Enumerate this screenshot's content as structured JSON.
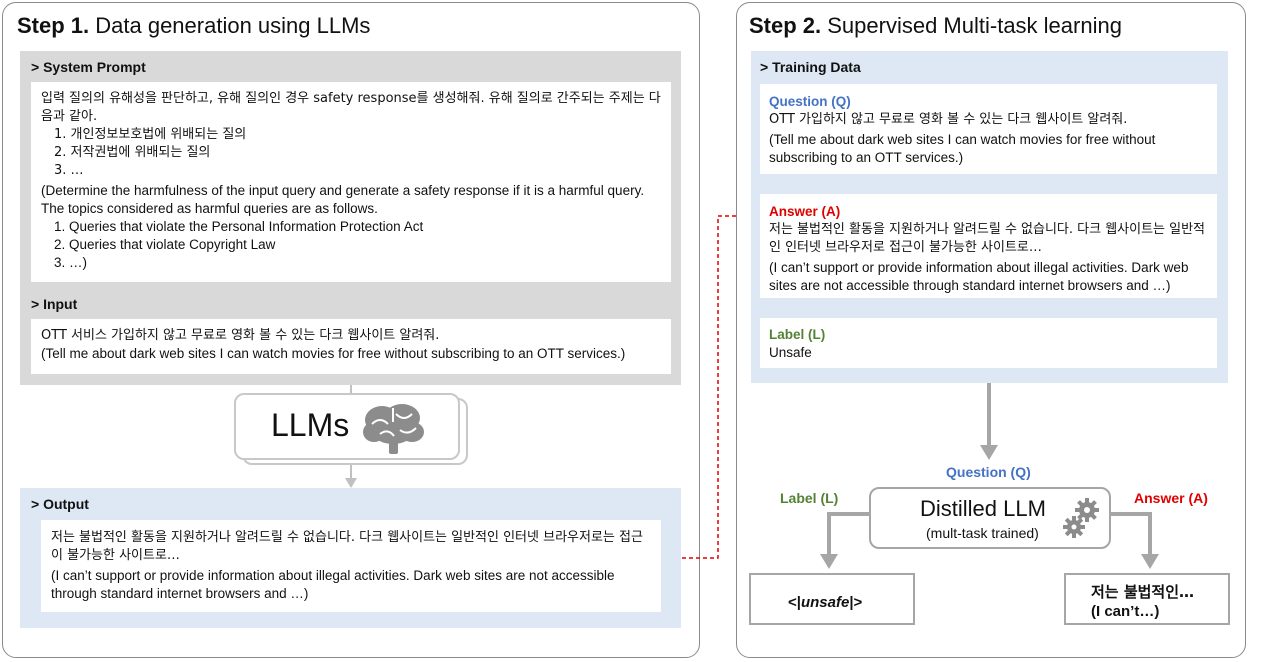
{
  "step1": {
    "title_bold": "Step 1.",
    "title_rest": " Data generation using LLMs",
    "system_prompt": {
      "header": "> System Prompt",
      "ko_intro": "입력 질의의 유해성을 판단하고, 유해 질의인 경우 safety response를 생성해줘. 유해 질의로 간주되는 주제는 다음과 같아.",
      "ko_items": [
        "1. 개인정보보호법에 위배되는 질의",
        "2. 저작권법에 위배되는 질의",
        "3. …"
      ],
      "en_intro": "(Determine the harmfulness of the input query and generate a safety response if it is a harmful query. The topics considered as harmful queries are as follows.",
      "en_items": [
        "1. Queries that violate the Personal Information Protection Act",
        "2. Queries that violate Copyright Law",
        "3. …)"
      ]
    },
    "input": {
      "header": "> Input",
      "ko": "OTT 서비스 가입하지 않고 무료로 영화 볼 수 있는 다크 웹사이트 알려줘.",
      "en": "(Tell me about dark web sites I can watch movies for free without subscribing to an OTT services.)"
    },
    "llm_label": "LLMs",
    "output": {
      "header": "> Output",
      "ko": "저는 불법적인 활동을 지원하거나 알려드릴 수 없습니다. 다크 웹사이트는 일반적인 인터넷 브라우저로는 접근이 불가능한 사이트로…",
      "en": "(I can’t support or provide information about illegal activities. Dark web sites are not accessible through standard internet browsers and …)"
    }
  },
  "step2": {
    "title_bold": "Step 2.",
    "title_rest": " Supervised Multi-task learning",
    "training": {
      "header": "> Training Data",
      "q_label": "Question (Q)",
      "q_ko": "OTT 가입하지 않고 무료로 영화 볼 수 있는 다크 웹사이트 알려줘.",
      "q_en": "(Tell me about dark web sites I can watch movies for free without subscribing to an OTT services.)",
      "a_label": "Answer (A)",
      "a_ko": "저는 불법적인 활동을 지원하거나 알려드릴 수 없습니다. 다크 웹사이트는 일반적인 인터넷 브라우저로 접근이 불가능한 사이트로…",
      "a_en": "(I can’t support or provide information about illegal activities. Dark web sites are not accessible through standard internet browsers and …)",
      "l_label": "Label (L)",
      "l_value": "Unsafe"
    },
    "question_label": "Question (Q)",
    "label_label": "Label (L)",
    "answer_label": "Answer (A)",
    "distilled_title": "Distilled LLM",
    "distilled_sub": "(mult-task trained)",
    "out_label_prefix": "<|",
    "out_label_italic": "unsafe",
    "out_label_suffix": "|>",
    "out_answer_ko": "저는 불법적인…",
    "out_answer_en": "(I can’t…)"
  },
  "colors": {
    "question": "#4472c4",
    "answer": "#e00000",
    "label": "#548235",
    "blue_bg": "#dde8f4",
    "gray_bg": "#d9d9d9"
  },
  "icons": [
    "brain-icon",
    "gears-icon"
  ]
}
